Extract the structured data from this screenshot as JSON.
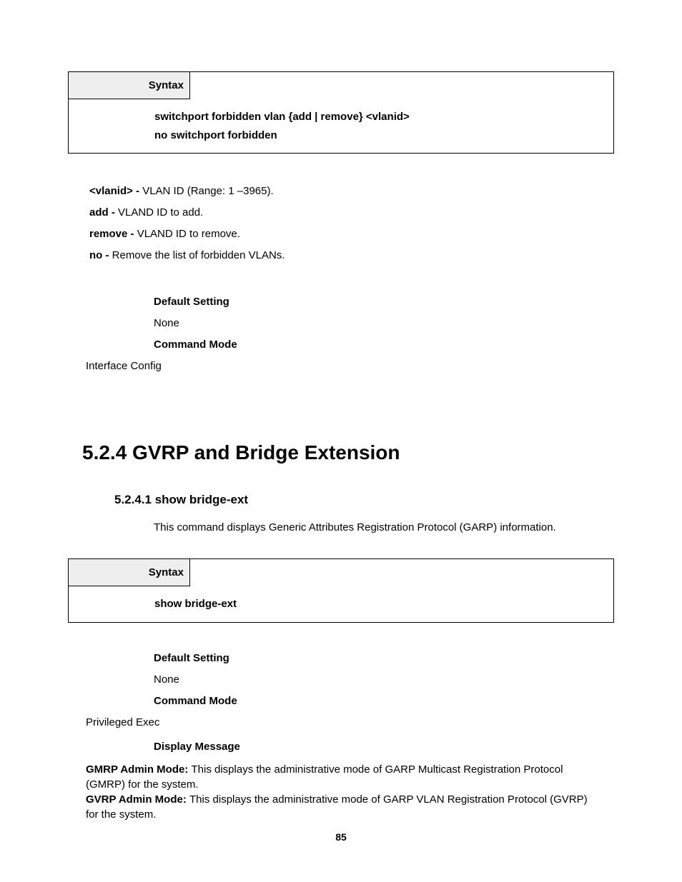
{
  "syntax_box_1": {
    "header": "Syntax",
    "line1": "switchport forbidden vlan {add | remove} <vlanid>",
    "line2": "no switchport forbidden"
  },
  "params": {
    "p1b": "<vlanid> - ",
    "p1t": "VLAN ID (Range: 1 –3965).",
    "p2b": "add - ",
    "p2t": "VLAND ID to add.",
    "p3b": "remove - ",
    "p3t": "VLAND ID to remove.",
    "p4b": "no - ",
    "p4t": "Remove the list of forbidden VLANs."
  },
  "settings1": {
    "default_label": "Default Setting",
    "default_value": "None",
    "mode_label": "Command Mode",
    "mode_value": "Interface Config"
  },
  "section_heading": "5.2.4 GVRP and Bridge Extension",
  "subsection_heading": "5.2.4.1 show bridge-ext",
  "subsection_desc": "This command displays Generic Attributes Registration Protocol (GARP) information.",
  "syntax_box_2": {
    "header": "Syntax",
    "body": "show bridge-ext"
  },
  "settings2": {
    "default_label": "Default Setting",
    "default_value": "None",
    "mode_label": "Command Mode",
    "mode_value": "Privileged Exec",
    "display_label": "Display Message"
  },
  "display_msg": {
    "l1b": "GMRP Admin Mode: ",
    "l1t": "This displays the administrative mode of GARP Multicast Registration Protocol (GMRP) for the system.",
    "l2b": "GVRP Admin Mode: ",
    "l2t": "This displays the administrative mode of GARP VLAN Registration Protocol (GVRP) for the system."
  },
  "page_number": "85"
}
